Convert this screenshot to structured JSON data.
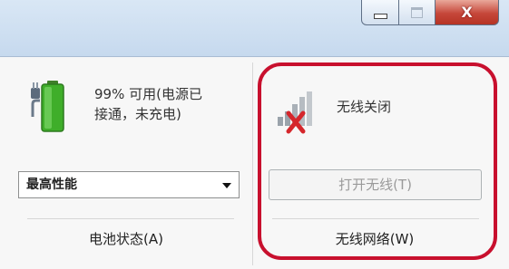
{
  "window": {
    "caption_buttons": {
      "minimize_icon": "minimize-icon",
      "maximize_icon": "maximize-icon",
      "close_glyph": "X"
    }
  },
  "battery": {
    "icon": "battery-plug-icon",
    "status_line1": "99% 可用(电源已",
    "status_line2": "接通，未充电)",
    "power_plan_value": "最高性能",
    "section_label": "电池状态(A)"
  },
  "wireless": {
    "icon": "wireless-signal-off-icon",
    "status_text": "无线关闭",
    "toggle_button_label": "打开无线(T)",
    "toggle_button_enabled": false,
    "section_label": "无线网络(W)",
    "highlight_color": "#c8102e"
  },
  "colors": {
    "titlebar": "#c6d9ee",
    "close_button": "#c6473a",
    "battery_green": "#3fae2a"
  }
}
